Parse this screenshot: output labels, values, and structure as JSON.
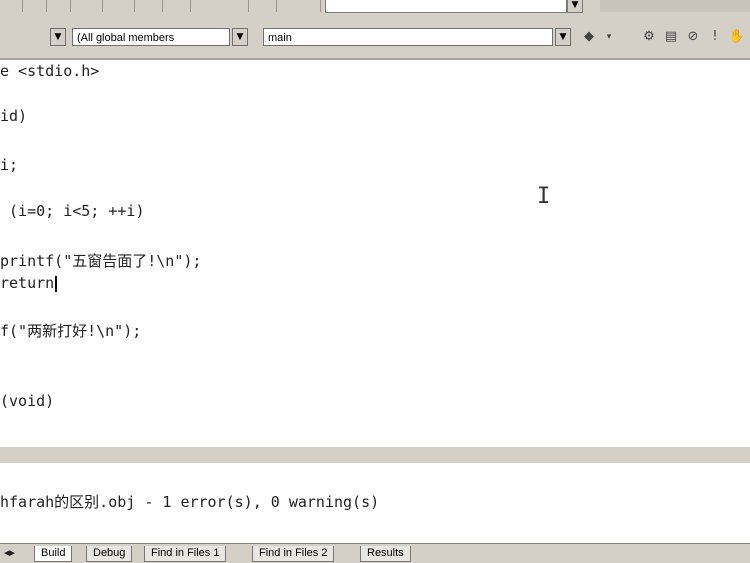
{
  "toolbar": {
    "find_value": "",
    "find_dropdown_icon": "chevron-down-icon"
  },
  "wizard_bar": {
    "filter_combo": "(All global members",
    "member_combo": "main",
    "colors": {
      "face": "#d4d0c8",
      "shadow": "#a8a49c"
    }
  },
  "editor": {
    "lines": [
      "e <stdio.h>",
      "id)",
      "i;",
      " (i=0; i<5; ++i)",
      "printf(\"五窗告面了!\\n\");",
      "return",
      "f(\"两新打好!\\n\");",
      "(void)"
    ]
  },
  "output": {
    "message": "hfarah的区别.obj - 1 error(s), 0 warning(s)"
  },
  "tabs": {
    "items": [
      "Build",
      "Debug",
      "Find in Files 1",
      "Find in Files 2",
      "Results"
    ],
    "active_index": 0
  }
}
